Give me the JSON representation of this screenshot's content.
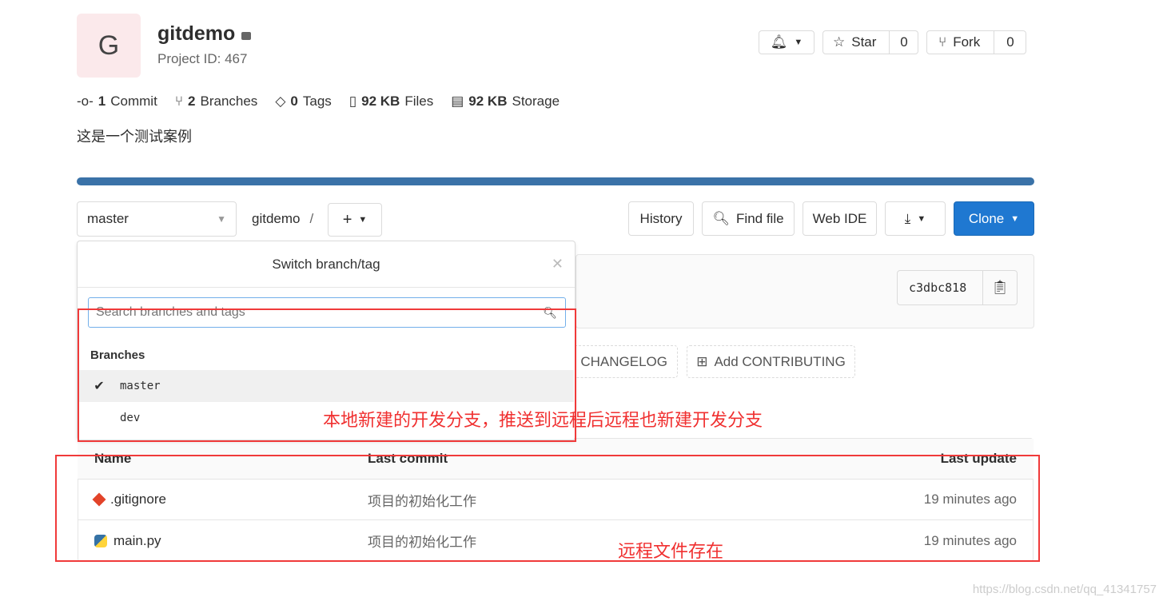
{
  "project": {
    "avatar_letter": "G",
    "name": "gitdemo",
    "id_label": "Project ID: 467",
    "description": "这是一个测试案例"
  },
  "header_actions": {
    "star_label": "Star",
    "star_count": "0",
    "fork_label": "Fork",
    "fork_count": "0"
  },
  "stats": [
    {
      "num": "1",
      "label": "Commit"
    },
    {
      "num": "2",
      "label": "Branches"
    },
    {
      "num": "0",
      "label": "Tags"
    },
    {
      "num": "92 KB",
      "label": "Files"
    },
    {
      "num": "92 KB",
      "label": "Storage"
    }
  ],
  "toolbar": {
    "branch": "master",
    "path_root": "gitdemo",
    "path_sep": "/",
    "history": "History",
    "find_file": "Find file",
    "web_ide": "Web IDE",
    "clone": "Clone"
  },
  "dropdown": {
    "title": "Switch branch/tag",
    "search_placeholder": "Search branches and tags",
    "section": "Branches",
    "branches": [
      {
        "name": "master",
        "selected": true
      },
      {
        "name": "dev",
        "selected": false
      }
    ]
  },
  "commit": {
    "sha": "c3dbc818"
  },
  "quick_actions": {
    "changelog": "d CHANGELOG",
    "contributing": "Add CONTRIBUTING"
  },
  "table": {
    "headers": [
      "Name",
      "Last commit",
      "Last update"
    ],
    "rows": [
      {
        "name": ".gitignore",
        "icon": "git-icon",
        "commit": "项目的初始化工作",
        "updated": "19 minutes ago"
      },
      {
        "name": "main.py",
        "icon": "python-icon",
        "commit": "项目的初始化工作",
        "updated": "19 minutes ago"
      }
    ]
  },
  "annotations": {
    "branch_note": "本地新建的开发分支，推送到远程后远程也新建开发分支",
    "files_note": "远程文件存在"
  },
  "watermark": "https://blog.csdn.net/qq_41341757",
  "colors": {
    "progress": "#3a72a8",
    "clone": "#1f78d1",
    "annotation": "#f03030"
  }
}
